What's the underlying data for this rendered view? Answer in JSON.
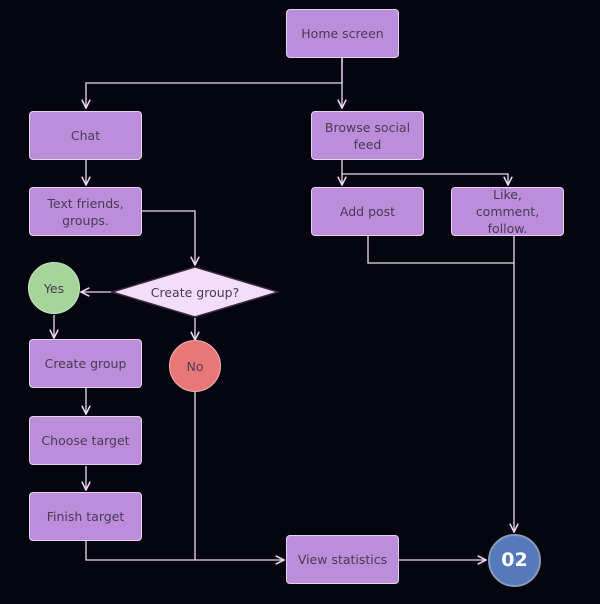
{
  "diagram": {
    "nodes": {
      "home_screen": "Home screen",
      "chat": "Chat",
      "browse_social_feed": "Browse social feed",
      "text_friends_groups": "Text friends, groups.",
      "add_post": "Add post",
      "like_comment_follow": "Like, comment, follow.",
      "create_group_decision": "Create group?",
      "yes": "Yes",
      "no": "No",
      "create_group": "Create group",
      "choose_target": "Choose target",
      "finish_target": "Finish target",
      "view_statistics": "View statistics",
      "end_marker": "02"
    },
    "edges": [
      {
        "from": "Home screen",
        "to": "Chat"
      },
      {
        "from": "Home screen",
        "to": "Browse social feed"
      },
      {
        "from": "Chat",
        "to": "Text friends, groups."
      },
      {
        "from": "Browse social feed",
        "to": "Add post"
      },
      {
        "from": "Browse social feed",
        "to": "Like, comment, follow."
      },
      {
        "from": "Text friends, groups.",
        "to": "Create group?"
      },
      {
        "from": "Create group?",
        "to": "Yes"
      },
      {
        "from": "Create group?",
        "to": "No"
      },
      {
        "from": "Yes",
        "to": "Create group"
      },
      {
        "from": "Create group",
        "to": "Choose target"
      },
      {
        "from": "Choose target",
        "to": "Finish target"
      },
      {
        "from": "Finish target",
        "to": "View statistics"
      },
      {
        "from": "No",
        "to": "View statistics"
      },
      {
        "from": "Add post",
        "to": "02"
      },
      {
        "from": "Like, comment, follow.",
        "to": "02"
      },
      {
        "from": "View statistics",
        "to": "02"
      }
    ],
    "colors": {
      "background": "#05050f",
      "process_box": "#bb8ddb",
      "decision": "#f5dcfa",
      "yes": "#a6d59b",
      "no": "#e87878",
      "end_marker": "#5579bb",
      "connector": "#efd8f5"
    }
  }
}
